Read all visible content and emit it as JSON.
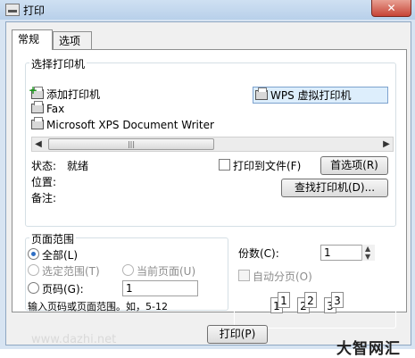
{
  "window": {
    "title": "打印",
    "close_label": "✕"
  },
  "tabs": [
    {
      "label": "常规"
    },
    {
      "label": "选项"
    }
  ],
  "select_printer": {
    "title": "选择打印机",
    "items": [
      {
        "label": "添加打印机",
        "icon": "add-printer-icon"
      },
      {
        "label": "WPS 虚拟打印机",
        "icon": "printer-icon",
        "selected": true
      },
      {
        "label": "Fax",
        "icon": "fax-icon"
      },
      {
        "label": "Microsoft XPS Document Writer",
        "icon": "printer-icon"
      }
    ],
    "scroll": {
      "left": "◀",
      "right": "▶",
      "thumb": "|||"
    },
    "status_label": "状态:",
    "status_value": "就绪",
    "location_label": "位置:",
    "comment_label": "备注:",
    "print_to_file_label": "打印到文件(F)",
    "preferences_button": "首选项(R)",
    "find_printer_button": "查找打印机(D)..."
  },
  "page_range": {
    "title": "页面范围",
    "all_label": "全部(L)",
    "selection_label": "选定范围(T)",
    "current_page_label": "当前页面(U)",
    "pages_label": "页码(G):",
    "pages_value": "1",
    "hint": "输入页码或页面范围。如，5-12"
  },
  "copies": {
    "label": "份数(C):",
    "value": "1",
    "collate_label": "自动分页(O)",
    "sheet_numbers": [
      "1",
      "1",
      "2",
      "2",
      "3",
      "3"
    ]
  },
  "footer": {
    "print_button": "打印(P)",
    "watermark": "www.dazhi.net",
    "brand": "大智网汇"
  }
}
